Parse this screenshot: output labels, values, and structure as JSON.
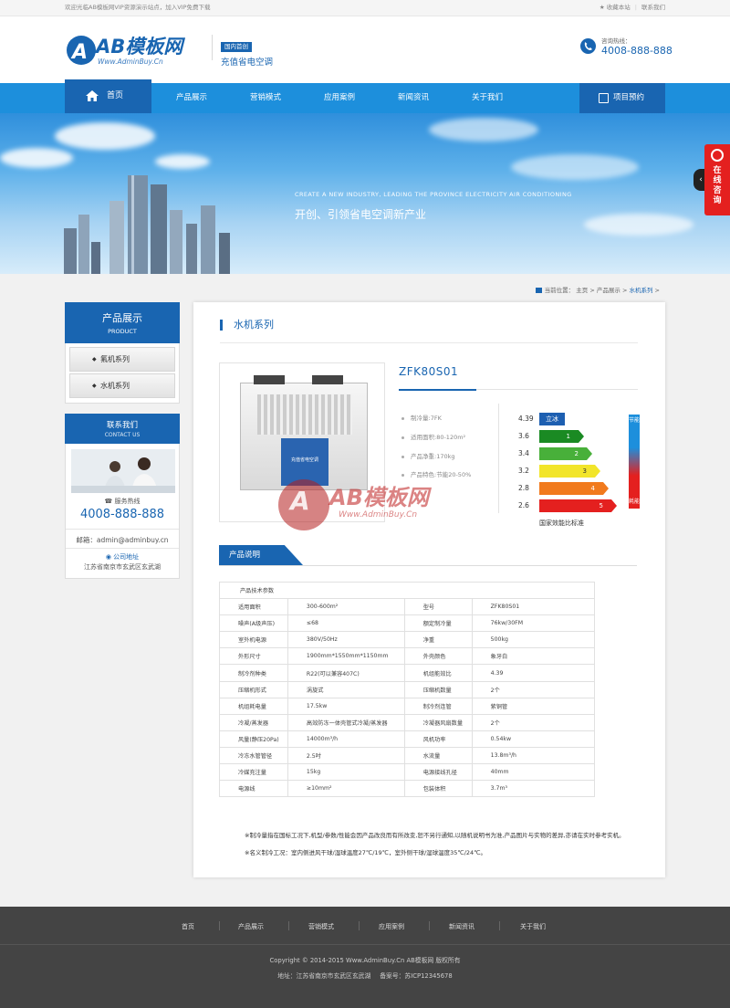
{
  "topbar": {
    "welcome": "欢迎光临AB模板网VIP资源演示站点，加入VIP免费下载",
    "favorite": "收藏本站",
    "contact": "联系我们"
  },
  "header": {
    "logo_text": "AB模板网",
    "logo_url": "Www.AdminBuy.Cn",
    "slogan_badge": "国内首创",
    "slogan_text": "充值省电空调",
    "hotline_label": "咨询热线：",
    "hotline_number": "4008-888-888"
  },
  "nav": {
    "home": "首页",
    "items": [
      "产品展示",
      "营销模式",
      "应用案例",
      "新闻资讯",
      "关于我们"
    ],
    "booking": "项目预约"
  },
  "banner": {
    "en": "CREATE A NEW INDUSTRY, LEADING THE PROVINCE ELECTRICITY AIR CONDITIONING",
    "cn": "开创、引领省电空调新产业"
  },
  "float": {
    "consult": "在线咨询",
    "arrow": "‹"
  },
  "breadcrumb": {
    "label": "当前位置：",
    "home": "主页",
    "sep": ">",
    "category": "产品展示",
    "current": "水机系列"
  },
  "sidebar": {
    "product_title": "产品展示",
    "product_en": "PRODUCT",
    "items": [
      "氟机系列",
      "水机系列"
    ],
    "contact_title": "联系我们",
    "contact_en": "CONTACT US",
    "service_label": "服务热线",
    "service_number": "4008-888-888",
    "email": "邮箱：admin@adminbuy.cn",
    "address_label": "公司地址",
    "address": "江苏省南京市玄武区玄武湖"
  },
  "main": {
    "title": "水机系列",
    "product_model": "ZFK80S01",
    "specs": [
      "制冷量:7FK",
      "适用面积:80-120m²",
      "产品净重:170kg",
      "产品特色:节能20-50%"
    ],
    "energy": {
      "rows": [
        {
          "value": "4.39",
          "label": "立冰",
          "color": "#1d5fb1",
          "level": 0
        },
        {
          "value": "3.6",
          "label": "1",
          "color": "#1a8a23",
          "level": 1
        },
        {
          "value": "3.4",
          "label": "2",
          "color": "#48b03a",
          "level": 2
        },
        {
          "value": "3.2",
          "label": "3",
          "color": "#f2e52a",
          "level": 3
        },
        {
          "value": "2.8",
          "label": "4",
          "color": "#f17a1d",
          "level": 4
        },
        {
          "value": "2.6",
          "label": "5",
          "color": "#e4201f",
          "level": 5
        }
      ],
      "caption": "国家效能比标准",
      "axis_top": "节能",
      "axis_bottom": "耗能"
    },
    "desc_tab": "产品说明",
    "table_header": "产品技术参数",
    "table_rows": [
      [
        "适用面积",
        "300-600m²",
        "型号",
        "ZFK80S01"
      ],
      [
        "噪声(A级声压)",
        "≤68",
        "额定制冷量",
        "76kw/30FM"
      ],
      [
        "室外机电源",
        "380V/50Hz",
        "净重",
        "500kg"
      ],
      [
        "外形尺寸",
        "1900mm*1550mm*1150mm",
        "外壳颜色",
        "象牙白"
      ],
      [
        "制冷剂种类",
        "R22(可以兼容407C)",
        "机组能效比",
        "4.39"
      ],
      [
        "压缩机形式",
        "涡旋式",
        "压缩机数量",
        "2个"
      ],
      [
        "机组耗电量",
        "17.5kw",
        "制冷剂连管",
        "紫铜管"
      ],
      [
        "冷凝/蒸发器",
        "高效防冻一体壳管式冷凝/蒸发器",
        "冷凝器风扇数量",
        "2个"
      ],
      [
        "风量(静压20Pa)",
        "14000m³/h",
        "风机功率",
        "0.54kw"
      ],
      [
        "冷冻水管管径",
        "2.5吋",
        "水流量",
        "13.8m³/h"
      ],
      [
        "冷媒充注量",
        "15kg",
        "电源接线孔径",
        "40mm"
      ],
      [
        "电源线",
        "≥10mm²",
        "包装体积",
        "3.7m³"
      ]
    ],
    "note1": "※制冷量指在国标工况下,机型/参数/性能会因产品改良而有所改变,恕不另行通知,以随机说明书为准,产品图片与实物的差异,亦请在实时参考实机。",
    "note2": "※名义制冷工况：室内侧进风干球/湿球温度27℃/19℃，室外侧干球/湿球温度35℃/24℃。"
  },
  "watermark": {
    "text": "AB模板网",
    "sub": "Www.AdminBuy.Cn"
  },
  "footer": {
    "nav": [
      "首页",
      "产品展示",
      "营销模式",
      "应用案例",
      "新闻资讯",
      "关于我们"
    ],
    "copyright": "Copyright © 2014-2015 Www.AdminBuy.Cn AB模板网 版权所有",
    "address": "地址：江苏省南京市玄武区玄武湖",
    "icp": "备案号：苏ICP12345678"
  },
  "colors": {
    "brand": "#1965b1",
    "nav": "#1d8fdc",
    "accent_red": "#e4201f",
    "footer": "#444444"
  }
}
